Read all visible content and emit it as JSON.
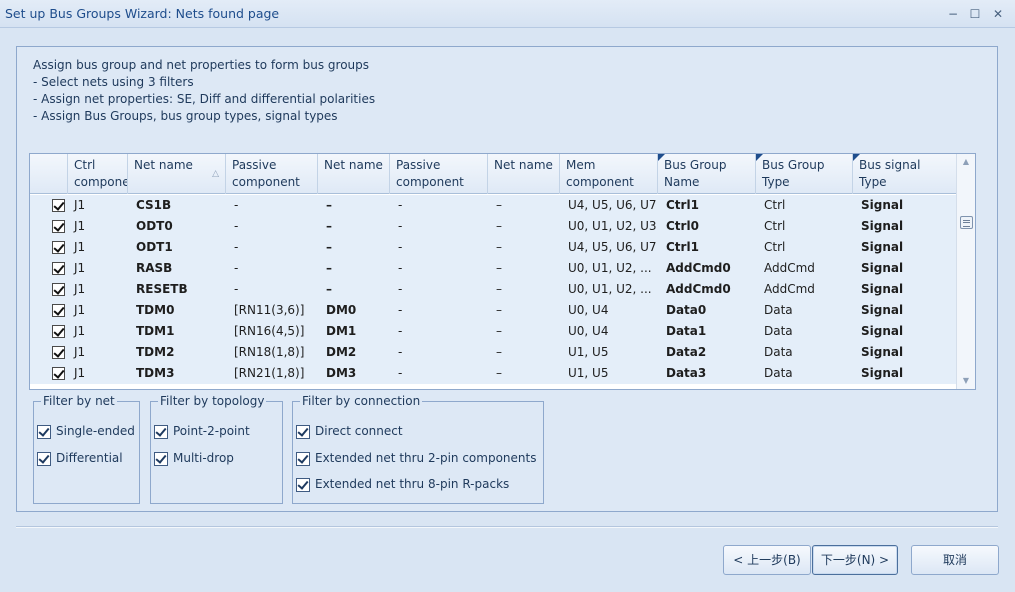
{
  "window": {
    "title": "Set up Bus Groups Wizard: Nets found page",
    "minimize": "−",
    "maximize": "☐",
    "close": "✕"
  },
  "instructions": [
    "Assign bus group and net properties to form bus groups",
    "- Select nets using 3 filters",
    "- Assign net properties: SE, Diff and differential polarities",
    "- Assign Bus Groups, bus group types, signal types"
  ],
  "grid": {
    "columns": [
      {
        "line1": "",
        "line2": ""
      },
      {
        "line1": "Ctrl",
        "line2": "component"
      },
      {
        "line1": "Net name",
        "line2": ""
      },
      {
        "line1": "Passive",
        "line2": "component"
      },
      {
        "line1": "Net name",
        "line2": ""
      },
      {
        "line1": "Passive",
        "line2": "component"
      },
      {
        "line1": "Net name",
        "line2": ""
      },
      {
        "line1": "Mem",
        "line2": "component"
      },
      {
        "line1": "Bus Group",
        "line2": "Name"
      },
      {
        "line1": "Bus Group",
        "line2": "Type"
      },
      {
        "line1": "Bus signal",
        "line2": "Type"
      }
    ],
    "sort_indicator": "△",
    "rows": [
      {
        "checked": true,
        "ctrl": "J1",
        "net1": "CS1B",
        "passive1": "-",
        "net2": "–",
        "passive2": "-",
        "net3": "–",
        "mem": "U4, U5, U6, U7",
        "bg_name": "Ctrl1",
        "bg_type": "Ctrl",
        "sig_type": "Signal"
      },
      {
        "checked": true,
        "ctrl": "J1",
        "net1": "ODT0",
        "passive1": "-",
        "net2": "–",
        "passive2": "-",
        "net3": "–",
        "mem": "U0, U1, U2, U3",
        "bg_name": "Ctrl0",
        "bg_type": "Ctrl",
        "sig_type": "Signal"
      },
      {
        "checked": true,
        "ctrl": "J1",
        "net1": "ODT1",
        "passive1": "-",
        "net2": "–",
        "passive2": "-",
        "net3": "–",
        "mem": "U4, U5, U6, U7",
        "bg_name": "Ctrl1",
        "bg_type": "Ctrl",
        "sig_type": "Signal"
      },
      {
        "checked": true,
        "ctrl": "J1",
        "net1": "RASB",
        "passive1": "-",
        "net2": "–",
        "passive2": "-",
        "net3": "–",
        "mem": "U0, U1, U2, ...",
        "bg_name": "AddCmd0",
        "bg_type": "AddCmd",
        "sig_type": "Signal"
      },
      {
        "checked": true,
        "ctrl": "J1",
        "net1": "RESETB",
        "passive1": "-",
        "net2": "–",
        "passive2": "-",
        "net3": "–",
        "mem": "U0, U1, U2, ...",
        "bg_name": "AddCmd0",
        "bg_type": "AddCmd",
        "sig_type": "Signal"
      },
      {
        "checked": true,
        "ctrl": "J1",
        "net1": "TDM0",
        "passive1": "[RN11(3,6)]",
        "net2": "DM0",
        "passive2": "-",
        "net3": "–",
        "mem": "U0, U4",
        "bg_name": "Data0",
        "bg_type": "Data",
        "sig_type": "Signal"
      },
      {
        "checked": true,
        "ctrl": "J1",
        "net1": "TDM1",
        "passive1": "[RN16(4,5)]",
        "net2": "DM1",
        "passive2": "-",
        "net3": "–",
        "mem": "U0, U4",
        "bg_name": "Data1",
        "bg_type": "Data",
        "sig_type": "Signal"
      },
      {
        "checked": true,
        "ctrl": "J1",
        "net1": "TDM2",
        "passive1": "[RN18(1,8)]",
        "net2": "DM2",
        "passive2": "-",
        "net3": "–",
        "mem": "U1, U5",
        "bg_name": "Data2",
        "bg_type": "Data",
        "sig_type": "Signal"
      },
      {
        "checked": true,
        "ctrl": "J1",
        "net1": "TDM3",
        "passive1": "[RN21(1,8)]",
        "net2": "DM3",
        "passive2": "-",
        "net3": "–",
        "mem": "U1, U5",
        "bg_name": "Data3",
        "bg_type": "Data",
        "sig_type": "Signal"
      }
    ]
  },
  "filters": {
    "by_net": {
      "title": "Filter by net",
      "options": [
        {
          "label": "Single-ended",
          "checked": true
        },
        {
          "label": "Differential",
          "checked": true
        }
      ]
    },
    "by_topology": {
      "title": "Filter by topology",
      "options": [
        {
          "label": "Point-2-point",
          "checked": true
        },
        {
          "label": "Multi-drop",
          "checked": true
        }
      ]
    },
    "by_connection": {
      "title": "Filter by connection",
      "options": [
        {
          "label": "Direct connect",
          "checked": true
        },
        {
          "label": "Extended net thru 2-pin components",
          "checked": true
        },
        {
          "label": "Extended net thru 8-pin R-packs",
          "checked": true
        }
      ]
    }
  },
  "buttons": {
    "back": "< 上一步(B)",
    "next": "下一步(N) >",
    "cancel": "取消"
  }
}
